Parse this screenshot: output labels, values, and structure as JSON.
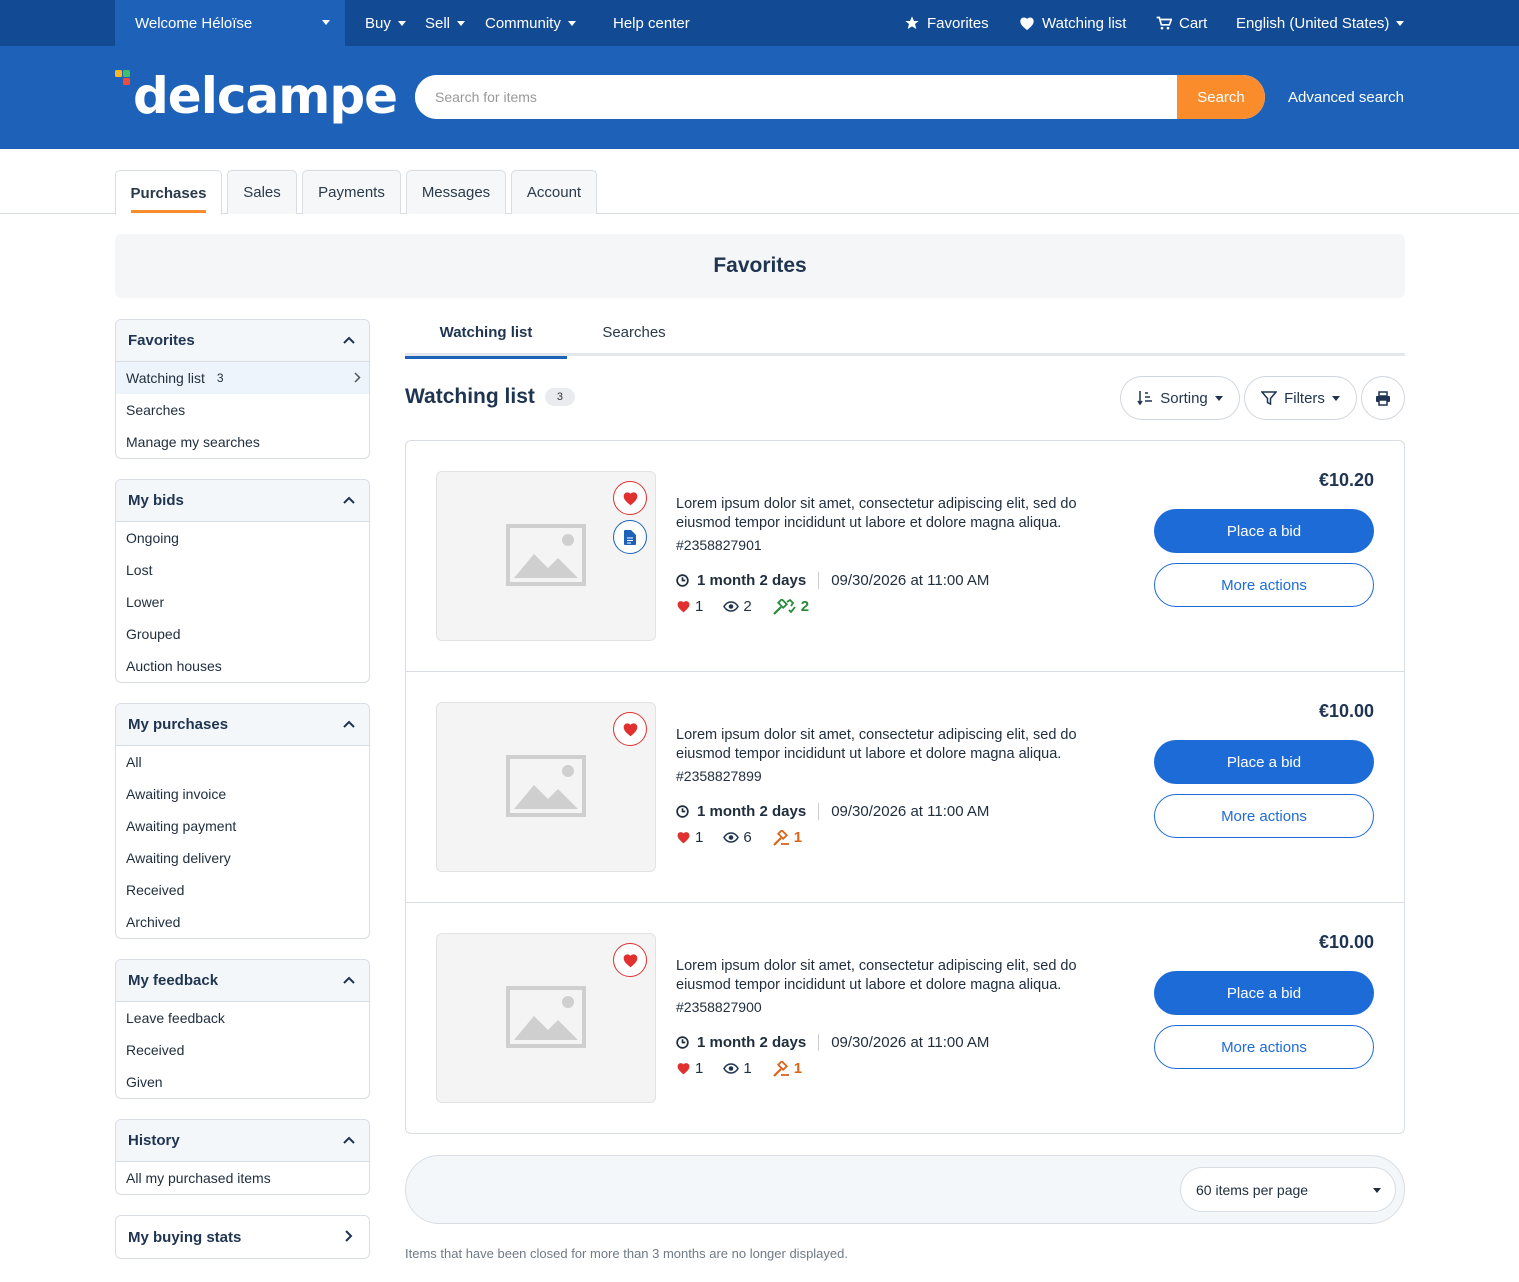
{
  "topbar": {
    "welcome": "Welcome Héloïse",
    "buy": "Buy",
    "sell": "Sell",
    "community": "Community",
    "help": "Help center",
    "favorites": "Favorites",
    "watching": "Watching list",
    "cart": "Cart",
    "language": "English (United States)"
  },
  "header": {
    "logo": "delcampe",
    "search_placeholder": "Search for items",
    "search_button": "Search",
    "advanced": "Advanced search"
  },
  "account_tabs": [
    "Purchases",
    "Sales",
    "Payments",
    "Messages",
    "Account"
  ],
  "page_title": "Favorites",
  "sidebar": {
    "favorites": {
      "title": "Favorites",
      "items": [
        "Watching list",
        "Searches",
        "Manage my searches"
      ],
      "watch_count": "3"
    },
    "bids": {
      "title": "My bids",
      "items": [
        "Ongoing",
        "Lost",
        "Lower",
        "Grouped",
        "Auction houses"
      ]
    },
    "purchases": {
      "title": "My purchases",
      "items": [
        "All",
        "Awaiting invoice",
        "Awaiting payment",
        "Awaiting delivery",
        "Received",
        "Archived"
      ]
    },
    "feedback": {
      "title": "My feedback",
      "items": [
        "Leave feedback",
        "Received",
        "Given"
      ]
    },
    "history": {
      "title": "History",
      "items": [
        "All my purchased items"
      ]
    },
    "stats": {
      "title": "My buying stats"
    }
  },
  "subtabs": [
    "Watching list",
    "Searches"
  ],
  "list": {
    "title": "Watching list",
    "count": "3",
    "sorting": "Sorting",
    "filters": "Filters"
  },
  "items": [
    {
      "desc": "Lorem ipsum dolor sit amet, consectetur adipiscing elit, sed do eiusmod tempor incididunt ut labore et dolore magna aliqua.",
      "ref": "#2358827901",
      "duration": "1 month 2 days",
      "date": "09/30/2026 at 11:00 AM",
      "likes": "1",
      "views": "2",
      "bids": "2",
      "price": "€10.20"
    },
    {
      "desc": "Lorem ipsum dolor sit amet, consectetur adipiscing elit, sed do eiusmod tempor incididunt ut labore et dolore magna aliqua.",
      "ref": "#2358827899",
      "duration": "1 month 2 days",
      "date": "09/30/2026 at 11:00 AM",
      "likes": "1",
      "views": "6",
      "bids": "1",
      "price": "€10.00"
    },
    {
      "desc": "Lorem ipsum dolor sit amet, consectetur adipiscing elit, sed do eiusmod tempor incididunt ut labore et dolore magna aliqua.",
      "ref": "#2358827900",
      "duration": "1 month 2 days",
      "date": "09/30/2026 at 11:00 AM",
      "likes": "1",
      "views": "1",
      "bids": "1",
      "price": "€10.00"
    }
  ],
  "buttons": {
    "bid": "Place a bid",
    "more": "More actions"
  },
  "pager": {
    "per_page": "60 items per page"
  },
  "footnote": "Items that have been closed for more than 3 months are no longer displayed.",
  "colors": {
    "brand": "#1d62b8",
    "topbar": "#124b94",
    "accent": "#fb8c2c",
    "heart": "#e0302f"
  }
}
